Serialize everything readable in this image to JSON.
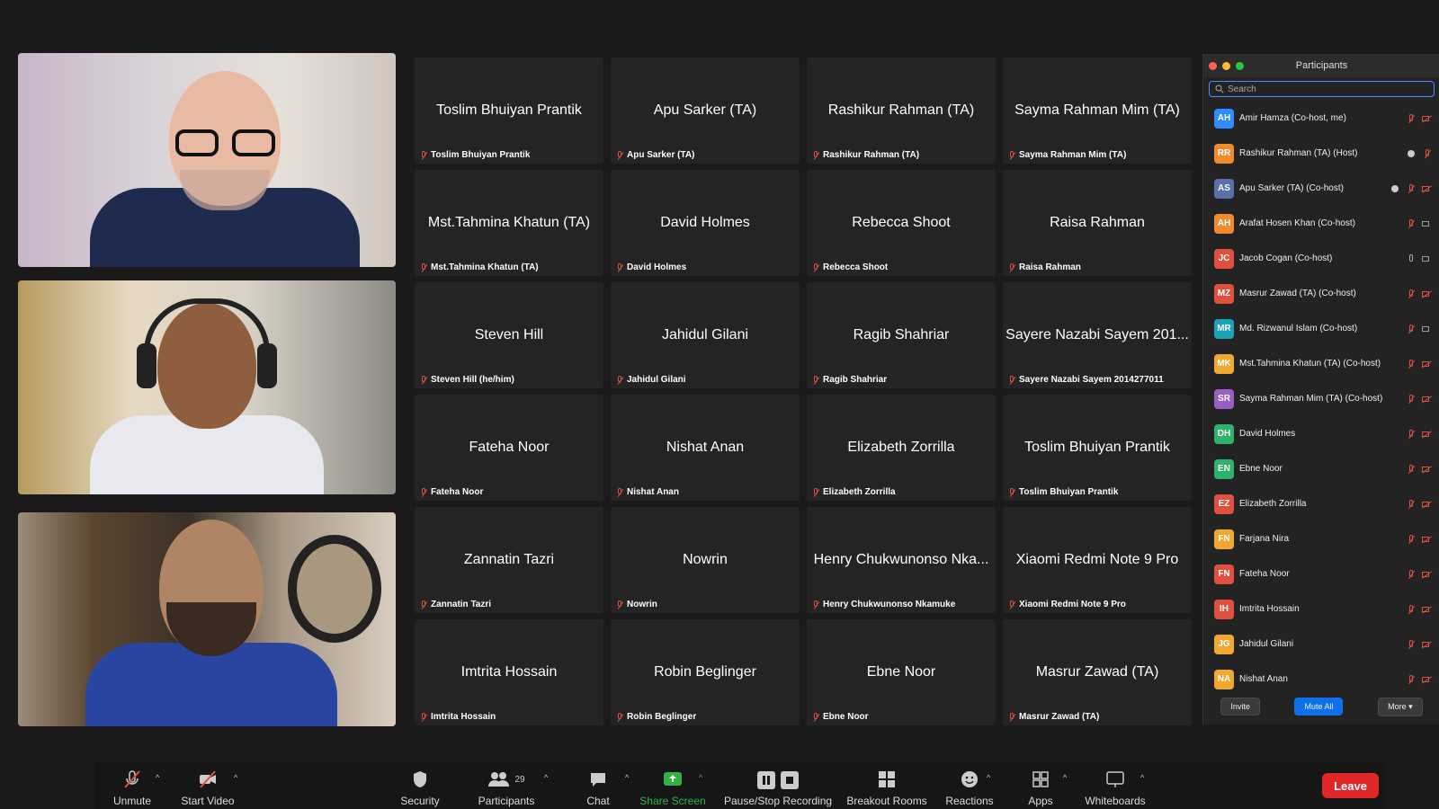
{
  "grid_tiles": [
    {
      "name": "Toslim Bhuiyan Prantik",
      "label": "Toslim Bhuiyan Prantik"
    },
    {
      "name": "Apu Sarker (TA)",
      "label": "Apu Sarker (TA)"
    },
    {
      "name": "Rashikur Rahman (TA)",
      "label": "Rashikur Rahman (TA)"
    },
    {
      "name": "Sayma Rahman Mim (TA)",
      "label": "Sayma Rahman Mim (TA)"
    },
    {
      "name": "Mst.Tahmina Khatun (TA)",
      "label": "Mst.Tahmina Khatun (TA)"
    },
    {
      "name": "David Holmes",
      "label": "David Holmes"
    },
    {
      "name": "Rebecca Shoot",
      "label": "Rebecca Shoot"
    },
    {
      "name": "Raisa Rahman",
      "label": "Raisa Rahman"
    },
    {
      "name": "Steven Hill",
      "label": "Steven Hill (he/him)"
    },
    {
      "name": "Jahidul Gilani",
      "label": "Jahidul Gilani"
    },
    {
      "name": "Ragib Shahriar",
      "label": "Ragib Shahriar"
    },
    {
      "name": "Sayere Nazabi Sayem 201...",
      "label": "Sayere Nazabi Sayem 2014277011"
    },
    {
      "name": "Fateha Noor",
      "label": "Fateha Noor"
    },
    {
      "name": "Nishat Anan",
      "label": "Nishat Anan"
    },
    {
      "name": "Elizabeth Zorrilla",
      "label": "Elizabeth Zorrilla"
    },
    {
      "name": "Toslim Bhuiyan Prantik",
      "label": "Toslim Bhuiyan Prantik"
    },
    {
      "name": "Zannatin Tazri",
      "label": "Zannatin Tazri"
    },
    {
      "name": "Nowrin",
      "label": "Nowrin"
    },
    {
      "name": "Henry Chukwunonso Nka...",
      "label": "Henry Chukwunonso Nkamuke"
    },
    {
      "name": "Xiaomi Redmi Note 9 Pro",
      "label": "Xiaomi Redmi Note 9 Pro"
    },
    {
      "name": "Imtrita Hossain",
      "label": "Imtrita Hossain"
    },
    {
      "name": "Robin Beglinger",
      "label": "Robin Beglinger"
    },
    {
      "name": "Ebne Noor",
      "label": "Ebne Noor"
    },
    {
      "name": "Masrur Zawad (TA)",
      "label": "Masrur Zawad (TA)"
    }
  ],
  "participants_panel": {
    "title": "Participants",
    "search_placeholder": "Search",
    "items": [
      {
        "initials": "AH",
        "color": "#2d8cff",
        "name": "Amir Hamza (Co-host, me)",
        "icons": [
          "mic-off",
          "cam-off"
        ]
      },
      {
        "initials": "RR",
        "color": "#f08c2e",
        "name": "Rashikur Rahman (TA) (Host)",
        "icons": [
          "share",
          "mic-off"
        ]
      },
      {
        "initials": "AS",
        "color": "#5b6fa8",
        "name": "Apu Sarker (TA) (Co-host)",
        "icons": [
          "share",
          "mic-off",
          "cam-off"
        ]
      },
      {
        "initials": "AH",
        "color": "#f08c2e",
        "name": "Arafat Hosen Khan (Co-host)",
        "icons": [
          "mic-off",
          "cam-gray"
        ]
      },
      {
        "initials": "JC",
        "color": "#e0503e",
        "name": "Jacob Cogan (Co-host)",
        "icons": [
          "mic-gray",
          "cam-gray"
        ]
      },
      {
        "initials": "MZ",
        "color": "#e0503e",
        "name": "Masrur Zawad (TA) (Co-host)",
        "icons": [
          "mic-off",
          "cam-off"
        ]
      },
      {
        "initials": "MR",
        "color": "#1aa3b5",
        "name": "Md. Rizwanul Islam (Co-host)",
        "icons": [
          "mic-off",
          "cam-gray"
        ]
      },
      {
        "initials": "MK",
        "color": "#f0a830",
        "name": "Mst.Tahmina Khatun (TA) (Co-host)",
        "icons": [
          "mic-off",
          "cam-off"
        ]
      },
      {
        "initials": "SR",
        "color": "#9a5fc0",
        "name": "Sayma Rahman Mim (TA) (Co-host)",
        "icons": [
          "mic-off",
          "cam-off"
        ]
      },
      {
        "initials": "DH",
        "color": "#2fb36b",
        "name": "David Holmes",
        "icons": [
          "mic-off",
          "cam-off"
        ]
      },
      {
        "initials": "EN",
        "color": "#2fb36b",
        "name": "Ebne Noor",
        "icons": [
          "mic-off",
          "cam-off"
        ]
      },
      {
        "initials": "EZ",
        "color": "#e0503e",
        "name": "Elizabeth Zorrilla",
        "icons": [
          "mic-off",
          "cam-off"
        ]
      },
      {
        "initials": "FN",
        "color": "#f0a830",
        "name": "Farjana Nira",
        "icons": [
          "mic-off",
          "cam-off"
        ]
      },
      {
        "initials": "FN",
        "color": "#e0503e",
        "name": "Fateha Noor",
        "icons": [
          "mic-off",
          "cam-off"
        ]
      },
      {
        "initials": "IH",
        "color": "#e0503e",
        "name": "Imtrita Hossain",
        "icons": [
          "mic-off",
          "cam-off"
        ]
      },
      {
        "initials": "JG",
        "color": "#f0a830",
        "name": "Jahidul Gilani",
        "icons": [
          "mic-off",
          "cam-off"
        ]
      },
      {
        "initials": "NA",
        "color": "#f0a830",
        "name": "Nishat Anan",
        "icons": [
          "mic-off",
          "cam-off"
        ]
      }
    ],
    "invite_label": "Invite",
    "mute_all_label": "Mute All",
    "more_label": "More"
  },
  "toolbar": {
    "unmute_label": "Unmute",
    "start_video_label": "Start Video",
    "security_label": "Security",
    "participants_label": "Participants",
    "participants_count": "29",
    "chat_label": "Chat",
    "share_screen_label": "Share Screen",
    "recording_label": "Pause/Stop Recording",
    "breakout_label": "Breakout Rooms",
    "reactions_label": "Reactions",
    "apps_label": "Apps",
    "whiteboards_label": "Whiteboards",
    "leave_label": "Leave",
    "accent_share": "#2fb344",
    "accent_leave": "#e02828"
  }
}
